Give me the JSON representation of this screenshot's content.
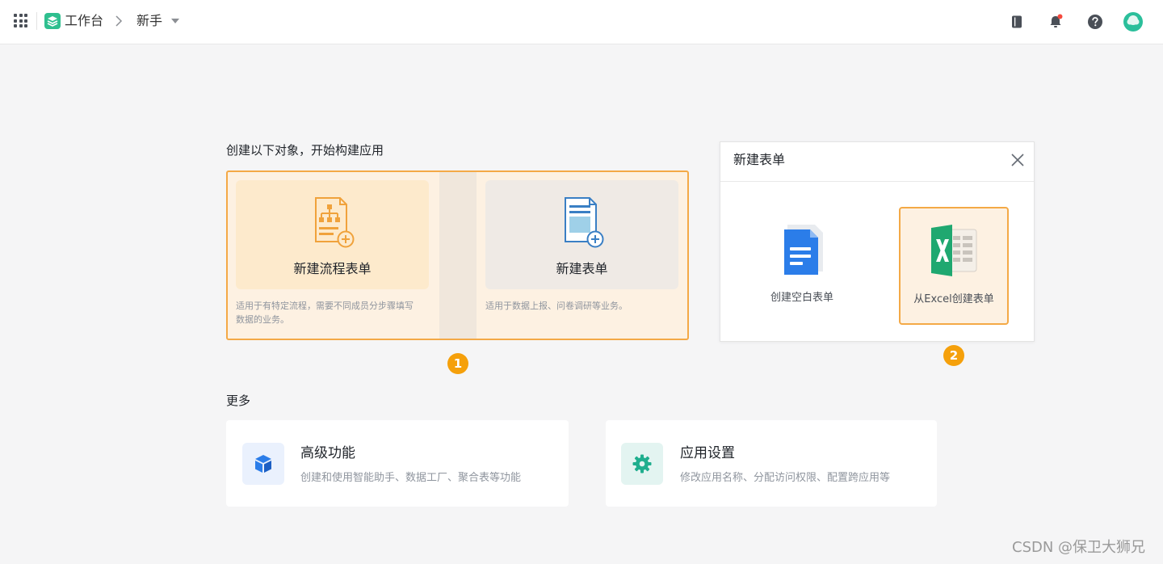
{
  "header": {
    "workspace_label": "工作台",
    "current_app": "新手"
  },
  "main": {
    "create_title": "创建以下对象，开始构建应用",
    "options": [
      {
        "label": "新建流程表单",
        "desc_line1": "适用于有特定流程，需要不同成员分步骤填写",
        "desc_line2": "数据的业务。"
      },
      {
        "label": "新建表单",
        "desc_line1": "适用于数据上报、问卷调研等业务。",
        "desc_line2": ""
      }
    ],
    "step1": "1",
    "step2": "2"
  },
  "dialog": {
    "title": "新建表单",
    "options": [
      {
        "label": "创建空白表单"
      },
      {
        "label": "从Excel创建表单"
      }
    ]
  },
  "more": {
    "title": "更多",
    "cards": [
      {
        "title": "高级功能",
        "desc": "创建和使用智能助手、数据工厂、聚合表等功能"
      },
      {
        "title": "应用设置",
        "desc": "修改应用名称、分配访问权限、配置跨应用等"
      }
    ]
  },
  "watermark": "CSDN @保卫大狮兄",
  "colors": {
    "accent_orange": "#f4a946",
    "badge_orange": "#f5a00b",
    "brand_green": "#2fbf8f",
    "excel_green": "#1fa870",
    "doc_blue": "#2b7de9"
  }
}
